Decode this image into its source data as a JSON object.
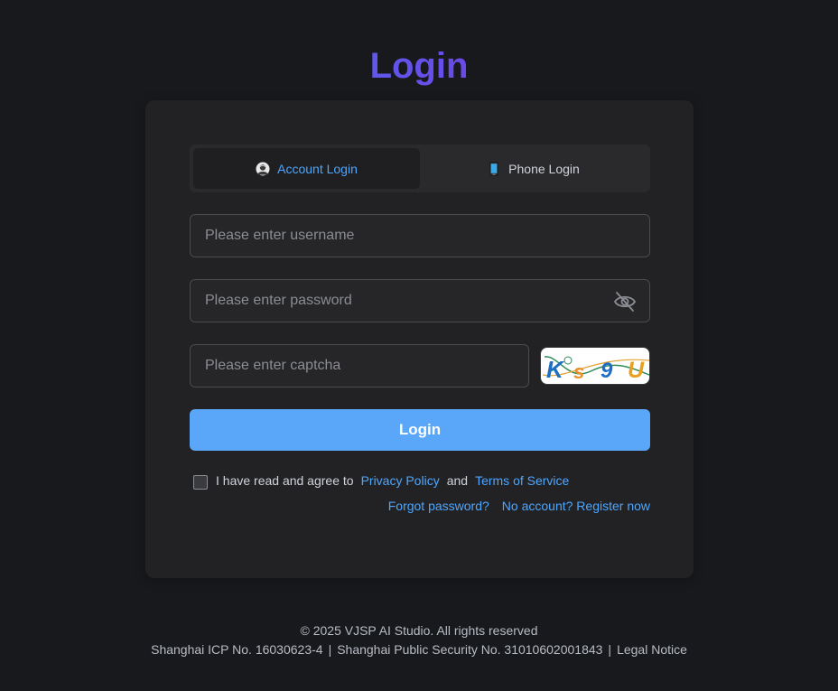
{
  "header": {
    "title": "Login"
  },
  "tabs": [
    {
      "label": "Account Login",
      "icon": "user-avatar-icon",
      "active": true
    },
    {
      "label": "Phone Login",
      "icon": "mobile-phone-icon",
      "active": false
    }
  ],
  "form": {
    "username_placeholder": "Please enter username",
    "password_placeholder": "Please enter password",
    "captcha_placeholder": "Please enter captcha",
    "captcha_text": "Ks9U",
    "login_label": "Login"
  },
  "agreement": {
    "prefix": "I have read and agree to",
    "privacy": "Privacy Policy",
    "and": "and",
    "terms": "Terms of Service",
    "checked": false
  },
  "links": {
    "forgot": "Forgot password?",
    "register": "No account? Register now"
  },
  "footer": {
    "copyright": "© 2025 VJSP AI Studio. All rights reserved",
    "icp": "Shanghai ICP No. 16030623-4",
    "security": "Shanghai Public Security No. 31010602001843",
    "legal": "Legal Notice"
  },
  "colors": {
    "accent": "#4da6ff",
    "button": "#5aa6f8",
    "background": "#18191c",
    "card": "#222224"
  }
}
